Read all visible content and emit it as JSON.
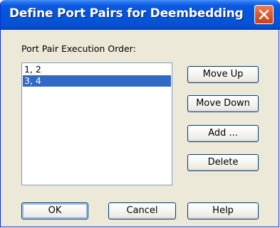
{
  "window": {
    "title": "Define Port Pairs for Deembedding"
  },
  "section": {
    "label": "Port Pair Execution Order:"
  },
  "list": {
    "items": [
      {
        "text": "1, 2",
        "selected": false
      },
      {
        "text": "3, 4",
        "selected": true
      }
    ]
  },
  "buttons": {
    "move_up": "Move Up",
    "move_down": "Move Down",
    "add": "Add ...",
    "delete": "Delete",
    "ok": "OK",
    "cancel": "Cancel",
    "help": "Help"
  },
  "colors": {
    "selection": "#316ac5",
    "titlebar": "#0455db",
    "close": "#e05a2e",
    "dialog_bg": "#ece9d8"
  },
  "icons": {
    "close": "close-icon"
  }
}
